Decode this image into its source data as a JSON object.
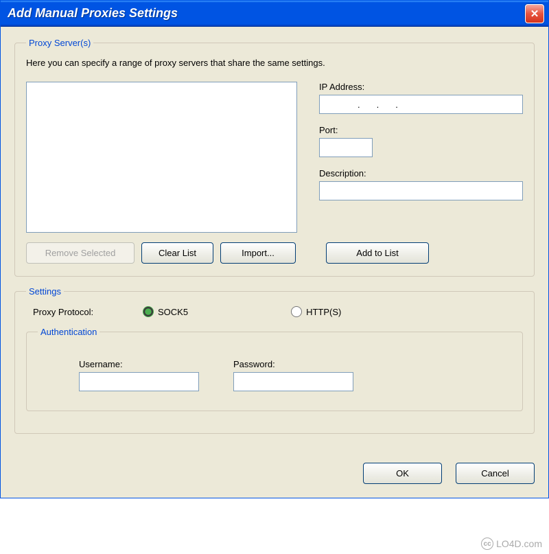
{
  "window": {
    "title": "Add Manual Proxies Settings"
  },
  "proxyServers": {
    "legend": "Proxy Server(s)",
    "helpText": "Here you can specify a range of proxy servers that share the same settings.",
    "ipLabel": "IP Address:",
    "ipValue": "...",
    "portLabel": "Port:",
    "portValue": "",
    "descLabel": "Description:",
    "descValue": "",
    "removeBtn": "Remove Selected",
    "clearBtn": "Clear List",
    "importBtn": "Import...",
    "addBtn": "Add to List"
  },
  "settings": {
    "legend": "Settings",
    "protocolLabel": "Proxy Protocol:",
    "sock5Label": "SOCK5",
    "httpsLabel": "HTTP(S)",
    "protocolSelected": "sock5"
  },
  "auth": {
    "legend": "Authentication",
    "usernameLabel": "Username:",
    "usernameValue": "",
    "passwordLabel": "Password:",
    "passwordValue": ""
  },
  "dialog": {
    "okBtn": "OK",
    "cancelBtn": "Cancel"
  },
  "watermark": "LO4D.com"
}
